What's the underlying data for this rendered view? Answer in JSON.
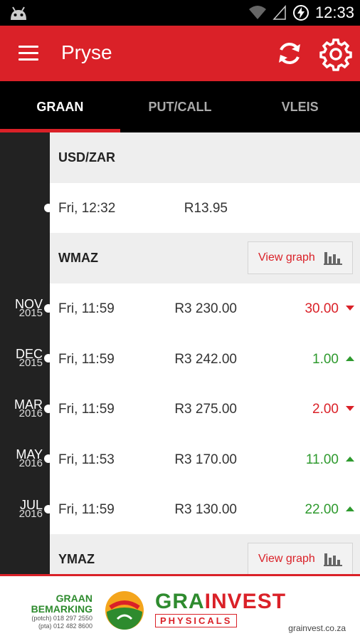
{
  "status_bar": {
    "time": "12:33"
  },
  "app_bar": {
    "title": "Pryse"
  },
  "tabs": [
    {
      "label": "GRAAN",
      "active": true
    },
    {
      "label": "PUT/CALL",
      "active": false
    },
    {
      "label": "VLEIS",
      "active": false
    }
  ],
  "sections": [
    {
      "name": "USD/ZAR",
      "rows": [
        {
          "date": "Fri, 12:32",
          "price": "R13.95"
        }
      ]
    },
    {
      "name": "WMAZ",
      "view_graph_label": "View graph",
      "rows": [
        {
          "month": "NOV",
          "year": "2015",
          "date": "Fri, 11:59",
          "price": "R3 230.00",
          "change": "30.00",
          "direction": "down"
        },
        {
          "month": "DEC",
          "year": "2015",
          "date": "Fri, 11:59",
          "price": "R3 242.00",
          "change": "1.00",
          "direction": "up"
        },
        {
          "month": "MAR",
          "year": "2016",
          "date": "Fri, 11:59",
          "price": "R3 275.00",
          "change": "2.00",
          "direction": "down"
        },
        {
          "month": "MAY",
          "year": "2016",
          "date": "Fri, 11:53",
          "price": "R3 170.00",
          "change": "11.00",
          "direction": "up"
        },
        {
          "month": "JUL",
          "year": "2016",
          "date": "Fri, 11:59",
          "price": "R3 130.00",
          "change": "22.00",
          "direction": "up"
        }
      ]
    },
    {
      "name": "YMAZ",
      "view_graph_label": "View graph"
    }
  ],
  "banner": {
    "graan_line1": "GRAAN",
    "graan_line2": "BEMARKING",
    "phone_potch": "(potch) 018 297 2550",
    "phone_pta": "(pta) 012 482 8600",
    "brand_green": "GRA",
    "brand_red": "INVEST",
    "brand_sub": "PHYSICALS",
    "url": "grainvest.co.za"
  },
  "colors": {
    "primary_red": "#da2128",
    "up_green": "#2e9a2e",
    "timeline_bg": "#222222"
  }
}
